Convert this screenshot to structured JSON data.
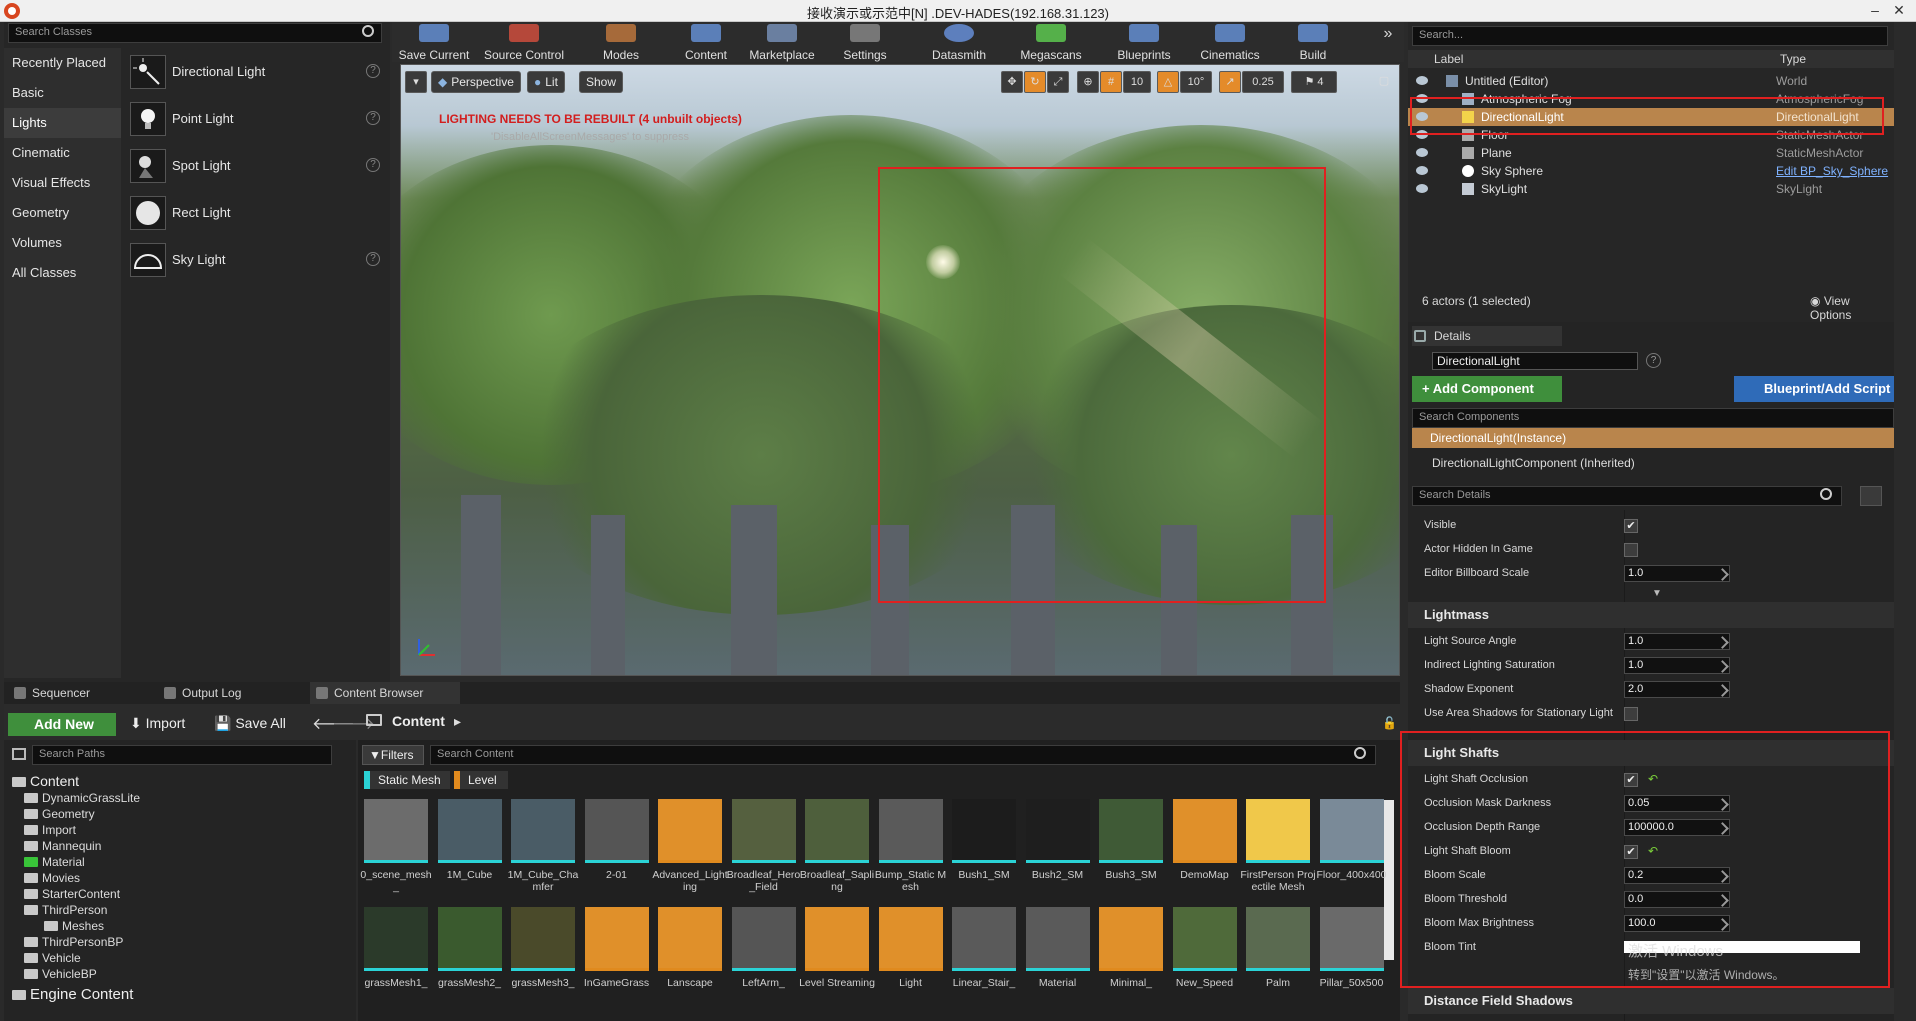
{
  "window": {
    "title": "接收演示或示范中[N] .DEV-HADES(192.168.31.123)"
  },
  "place_mode": {
    "search_placeholder": "Search Classes",
    "categories": [
      "Recently Placed",
      "Basic",
      "Lights",
      "Cinematic",
      "Visual Effects",
      "Geometry",
      "Volumes",
      "All Classes"
    ],
    "items": [
      "Directional Light",
      "Point Light",
      "Spot Light",
      "Rect Light",
      "Sky Light"
    ]
  },
  "toolbar": {
    "buttons": [
      "Save Current",
      "Source Control",
      "Modes",
      "Content",
      "Marketplace",
      "Settings",
      "Datasmith",
      "Megascans",
      "Blueprints",
      "Cinematics",
      "Build"
    ],
    "overflow": "»"
  },
  "viewport": {
    "perspective": "Perspective",
    "lit": "Lit",
    "show": "Show",
    "grid_snap": "10",
    "rot_snap": "10°",
    "scale_snap": "0.25",
    "cam_speed": "4",
    "warning": "LIGHTING NEEDS TO BE REBUILT (4 unbuilt objects)",
    "warning_sub": "'DisableAllScreenMessages' to suppress"
  },
  "outliner": {
    "search_placeholder": "Search...",
    "col_label": "Label",
    "col_type": "Type",
    "rows": [
      {
        "name": "Untitled (Editor)",
        "type": "World"
      },
      {
        "name": "Atmospheric Fog",
        "type": "AtmosphericFog"
      },
      {
        "name": "DirectionalLight",
        "type": "DirectionalLight"
      },
      {
        "name": "Floor",
        "type": "StaticMeshActor"
      },
      {
        "name": "Plane",
        "type": "StaticMeshActor"
      },
      {
        "name": "Sky Sphere",
        "type": "Edit BP_Sky_Sphere"
      },
      {
        "name": "SkyLight",
        "type": "SkyLight"
      }
    ],
    "footer": "6 actors (1 selected)",
    "view_options": "View Options"
  },
  "details": {
    "tab": "Details",
    "name_value": "DirectionalLight",
    "add_component": "+ Add Component",
    "blueprint": "Blueprint/Add Script",
    "search_components": "Search Components",
    "instance": "DirectionalLight(Instance)",
    "component": "DirectionalLightComponent (Inherited)",
    "search_details": "Search Details",
    "rows_top": [
      {
        "label": "Visible",
        "kind": "check",
        "value": "✔"
      },
      {
        "label": "Actor Hidden In Game",
        "kind": "check",
        "value": ""
      },
      {
        "label": "Editor Billboard Scale",
        "kind": "num",
        "value": "1.0"
      }
    ],
    "lightmass_title": "Lightmass",
    "lightmass_rows": [
      {
        "label": "Light Source Angle",
        "kind": "num",
        "value": "1.0"
      },
      {
        "label": "Indirect Lighting Saturation",
        "kind": "num",
        "value": "1.0"
      },
      {
        "label": "Shadow Exponent",
        "kind": "num",
        "value": "2.0"
      },
      {
        "label": "Use Area Shadows for Stationary Light",
        "kind": "check",
        "value": ""
      }
    ],
    "shafts_title": "Light Shafts",
    "shafts_rows": [
      {
        "label": "Light Shaft Occlusion",
        "kind": "check",
        "value": "✔"
      },
      {
        "label": "Occlusion Mask Darkness",
        "kind": "num",
        "value": "0.05"
      },
      {
        "label": "Occlusion Depth Range",
        "kind": "num",
        "value": "100000.0"
      },
      {
        "label": "Light Shaft Bloom",
        "kind": "check",
        "value": "✔"
      },
      {
        "label": "Bloom Scale",
        "kind": "num",
        "value": "0.2"
      },
      {
        "label": "Bloom Threshold",
        "kind": "num",
        "value": "0.0"
      },
      {
        "label": "Bloom Max Brightness",
        "kind": "num",
        "value": "100.0"
      },
      {
        "label": "Bloom Tint",
        "kind": "color",
        "value": ""
      }
    ],
    "next_section": "Distance Field Shadows",
    "watermark1": "激活 Windows",
    "watermark2": "转到\"设置\"以激活 Windows。"
  },
  "bottom_tabs": [
    "Sequencer",
    "Output Log",
    "Content Browser"
  ],
  "content_browser": {
    "add_new": "Add New",
    "import": "Import",
    "save_all": "Save All",
    "path": "Content",
    "search_paths": "Search Paths",
    "filters": "Filters",
    "search_content": "Search Content",
    "filter_chips": [
      "Static Mesh",
      "Level"
    ],
    "tree": [
      {
        "label": "Content",
        "level": 0
      },
      {
        "label": "DynamicGrassLite",
        "level": 1
      },
      {
        "label": "Geometry",
        "level": 1
      },
      {
        "label": "Import",
        "level": 1
      },
      {
        "label": "Mannequin",
        "level": 1
      },
      {
        "label": "Material",
        "level": 1
      },
      {
        "label": "Movies",
        "level": 1
      },
      {
        "label": "StarterContent",
        "level": 1
      },
      {
        "label": "ThirdPerson",
        "level": 1
      },
      {
        "label": "Meshes",
        "level": 2
      },
      {
        "label": "ThirdPersonBP",
        "level": 1
      },
      {
        "label": "Vehicle",
        "level": 1
      },
      {
        "label": "VehicleBP",
        "level": 1
      },
      {
        "label": "Engine Content",
        "level": 0
      }
    ],
    "assets_row1": [
      "0_scene_mesh_",
      "1M_Cube",
      "1M_Cube_Chamfer",
      "2-01",
      "Advanced_Lighting",
      "Broadleaf_Hero_Field",
      "Broadleaf_Sapling",
      "Bump_Static Mesh",
      "Bush1_SM",
      "Bush2_SM",
      "Bush3_SM",
      "DemoMap",
      "FirstPerson Projectile Mesh",
      "Floor_400x400"
    ],
    "assets_row2": [
      "grassMesh1_",
      "grassMesh2_",
      "grassMesh3_",
      "InGameGrass",
      "Lanscape",
      "LeftArm_",
      "Level Streaming",
      "Light",
      "Linear_Stair_",
      "Material",
      "Minimal_",
      "New_Speed",
      "Palm",
      "Pillar_50x500"
    ]
  }
}
